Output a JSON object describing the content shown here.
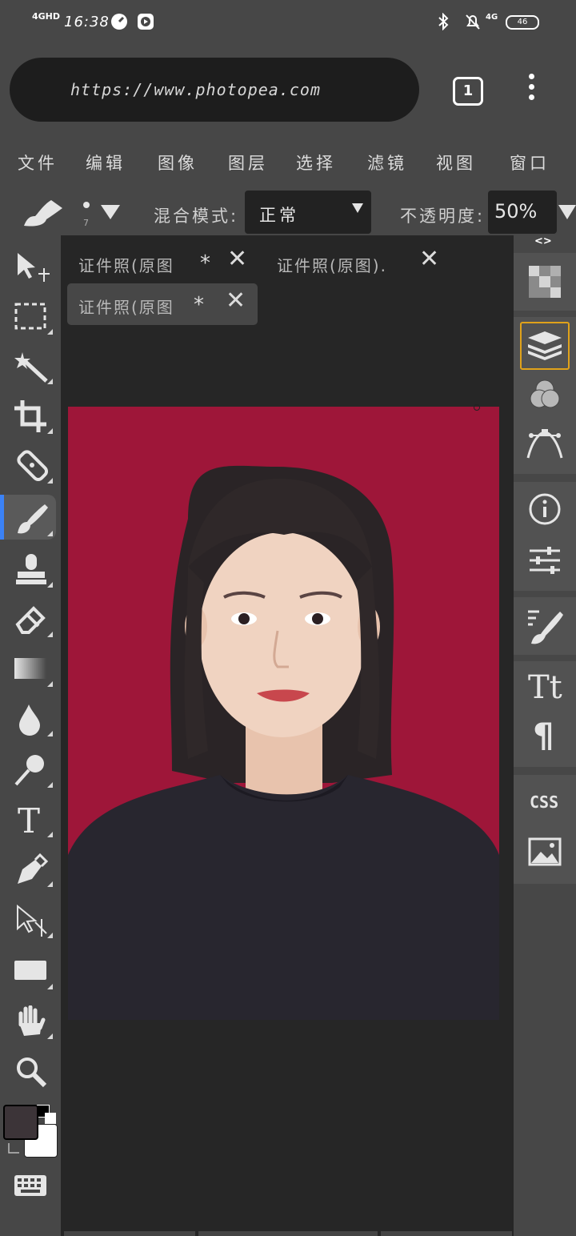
{
  "status_bar": {
    "network": "4GHD",
    "time": "16:38",
    "network_right": "4G",
    "battery": "46"
  },
  "browser": {
    "url": "https://www.photopea.com",
    "tab_count": "1"
  },
  "menu": {
    "items": [
      "文件",
      "编辑",
      "图像",
      "图层",
      "选择",
      "滤镜",
      "视图",
      "窗口"
    ]
  },
  "options": {
    "brush_size": "7",
    "blend_label": "混合模式:",
    "blend_value": "正常",
    "opacity_label": "不透明度:",
    "opacity_value": "50%"
  },
  "documents": {
    "tabs": [
      {
        "label": "证件照(原图",
        "mark": "*"
      },
      {
        "label": "证件照(原图).",
        "mark": ""
      },
      {
        "label": "证件照(原图",
        "mark": "*"
      }
    ]
  },
  "right_panel": {
    "toggle": "<>",
    "css_label": "CSS",
    "type_label": "Tt",
    "para_label": "¶"
  },
  "colors": {
    "accent_blue": "#3b82f6",
    "selected_outline": "#e0a21a",
    "canvas_bg": "#9e1639",
    "foreground": "#3c3438",
    "background": "#ffffff"
  }
}
